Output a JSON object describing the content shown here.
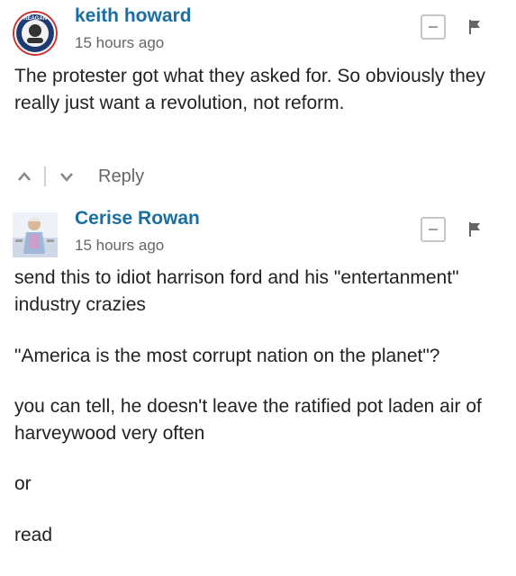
{
  "comments": [
    {
      "author": "keith howard",
      "time": "15 hours ago",
      "avatar_text": "REAGAN",
      "paragraphs": [
        "The protester got what they asked for. So obviously they really just want a revolution, not reform."
      ],
      "actions": {
        "reply_label": "Reply"
      }
    },
    {
      "author": "Cerise Rowan",
      "time": "15 hours ago",
      "paragraphs": [
        "send this to idiot harrison ford and his \"entertanment\" industry crazies",
        "\"America is the most corrupt nation on the planet\"?",
        "you can tell, he doesn't leave the ratified pot laden air of harveywood very often",
        "or",
        "read"
      ]
    }
  ],
  "icons": {
    "collapse": "minus-box-icon",
    "flag": "flag-icon",
    "upvote": "chevron-up-icon",
    "downvote": "chevron-down-icon"
  },
  "colors": {
    "author": "#1a6fa0",
    "meta": "#666666",
    "text": "#222222",
    "border": "#c2c7cc"
  }
}
